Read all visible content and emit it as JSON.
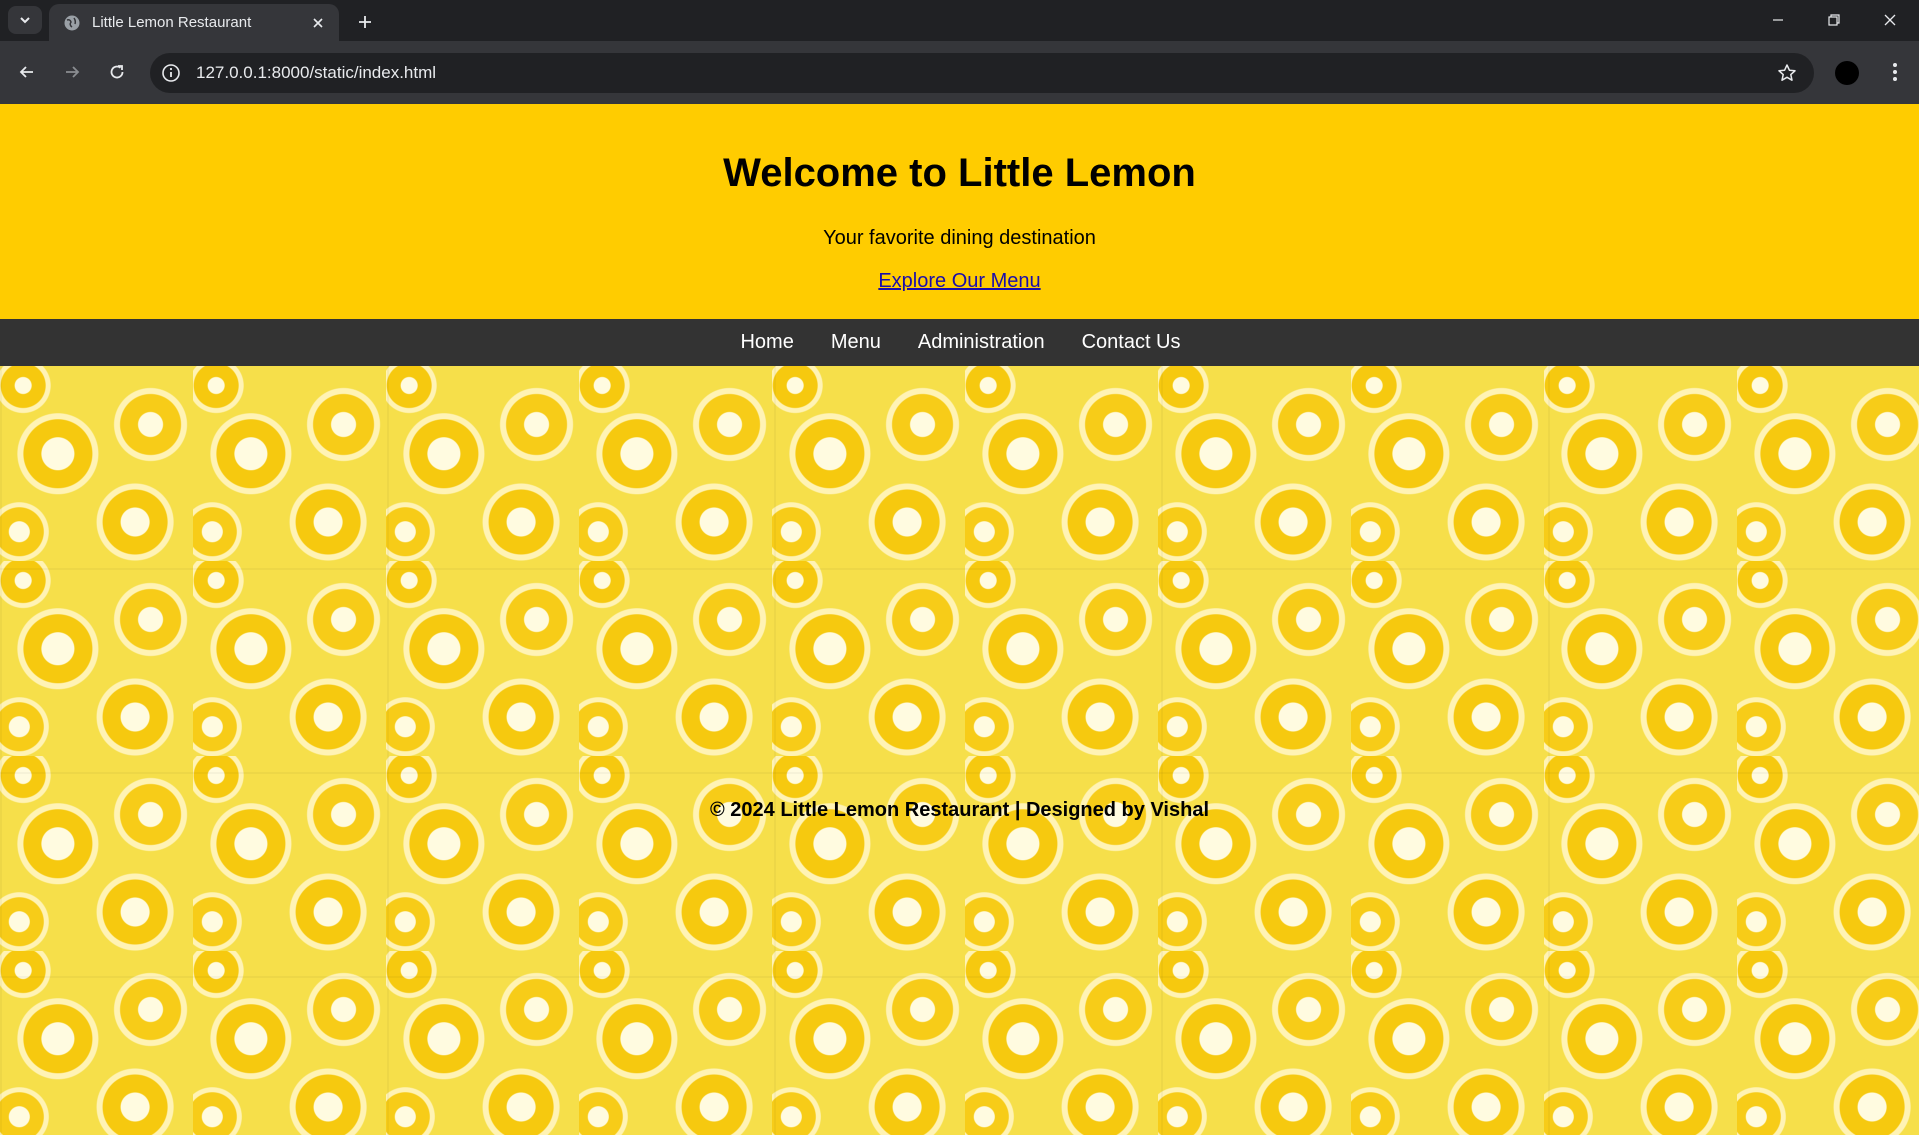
{
  "browser": {
    "tab_title": "Little Lemon Restaurant",
    "url": "127.0.0.1:8000/static/index.html"
  },
  "header": {
    "title": "Welcome to Little Lemon",
    "tagline": "Your favorite dining destination",
    "menu_link": "Explore Our Menu"
  },
  "nav": {
    "items": [
      "Home",
      "Menu",
      "Administration",
      "Contact Us"
    ]
  },
  "footer": {
    "text": "© 2024 Little Lemon Restaurant | Designed by Vishal"
  },
  "colors": {
    "header_bg": "#ffcc00",
    "nav_bg": "#333333",
    "link": "#1a0dab"
  }
}
